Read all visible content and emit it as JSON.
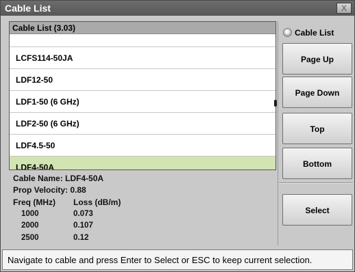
{
  "window": {
    "title": "Cable List",
    "close_label": "X"
  },
  "list": {
    "header": "Cable List (3.03)",
    "items": [
      {
        "label": "LCFS114-50JA",
        "selected": false
      },
      {
        "label": "LDF12-50",
        "selected": false
      },
      {
        "label": "LDF1-50 (6 GHz)",
        "selected": false
      },
      {
        "label": "LDF2-50 (6 GHz)",
        "selected": false
      },
      {
        "label": "LDF4.5-50",
        "selected": false
      },
      {
        "label": "LDF4-50A",
        "selected": true
      }
    ]
  },
  "info": {
    "cable_name": "Cable Name: LDF4-50A",
    "prop_velocity": "Prop Velocity: 0.88",
    "freq_header": "Freq (MHz)",
    "loss_header": "Loss (dB/m)",
    "rows": [
      {
        "freq": "1000",
        "loss": "0.073"
      },
      {
        "freq": "2000",
        "loss": "0.107"
      },
      {
        "freq": "2500",
        "loss": "0.12"
      }
    ]
  },
  "sidebar": {
    "radio_label": "Cable List",
    "page_up": "Page Up",
    "page_down": "Page Down",
    "top": "Top",
    "bottom": "Bottom",
    "select": "Select"
  },
  "status": "Navigate to cable and press Enter to Select or ESC to keep current selection.",
  "colors": {
    "selected_row": "#d2e4b2",
    "titlebar": "#606060"
  }
}
